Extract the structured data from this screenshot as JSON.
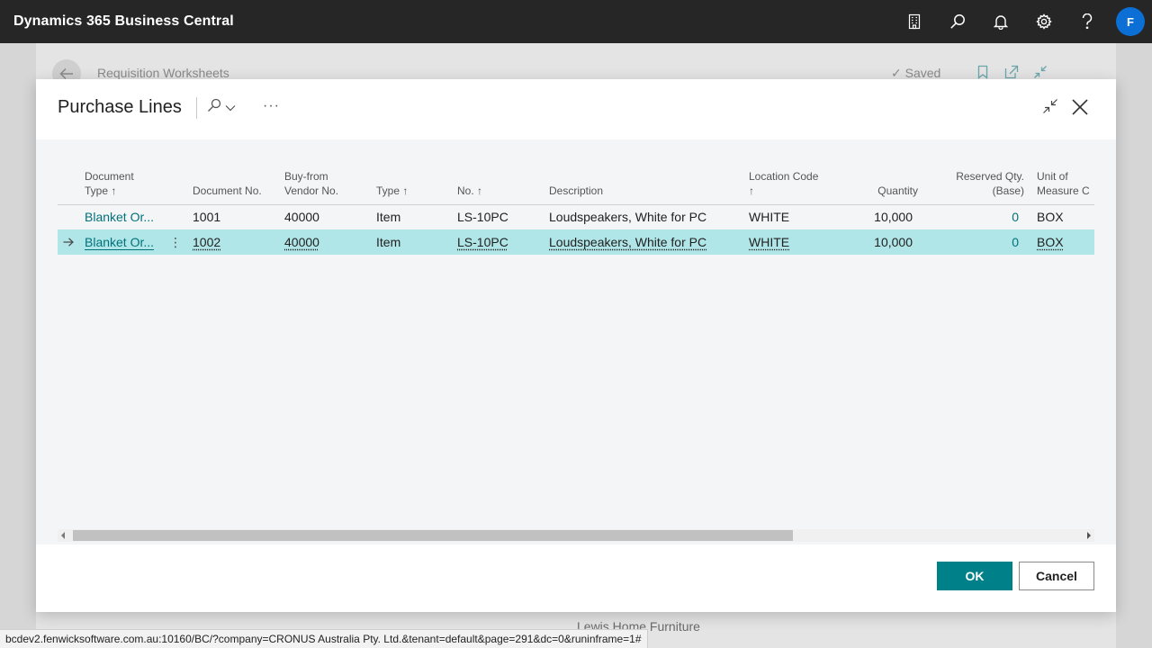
{
  "app": {
    "title": "Dynamics 365 Business Central",
    "avatar_initial": "F"
  },
  "background_page": {
    "breadcrumb": "Requisition Worksheets",
    "saved_label": "Saved",
    "company_name": "Lewis Home Furniture"
  },
  "dialog": {
    "title": "Purchase Lines",
    "columns": [
      {
        "line1": "Document",
        "line2": "Type ↑"
      },
      {
        "line1": "",
        "line2": "Document No."
      },
      {
        "line1": "Buy-from",
        "line2": "Vendor No."
      },
      {
        "line1": "",
        "line2": "Type ↑"
      },
      {
        "line1": "",
        "line2": "No. ↑"
      },
      {
        "line1": "",
        "line2": "Description"
      },
      {
        "line1": "Location Code",
        "line2": "↑"
      },
      {
        "line1": "",
        "line2": "Quantity"
      },
      {
        "line1": "Reserved Qty.",
        "line2": "(Base)"
      },
      {
        "line1": "Unit of",
        "line2": "Measure C"
      }
    ],
    "rows": [
      {
        "document_type": "Blanket Or...",
        "document_no": "1001",
        "vendor_no": "40000",
        "type": "Item",
        "no": "LS-10PC",
        "description": "Loudspeakers, White for PC",
        "location_code": "WHITE",
        "quantity": "10,000",
        "reserved_qty": "0",
        "uom": "BOX",
        "selected": false
      },
      {
        "document_type": "Blanket Or...",
        "document_no": "1002",
        "vendor_no": "40000",
        "type": "Item",
        "no": "LS-10PC",
        "description": "Loudspeakers, White for PC",
        "location_code": "WHITE",
        "quantity": "10,000",
        "reserved_qty": "0",
        "uom": "BOX",
        "selected": true
      }
    ],
    "ok_label": "OK",
    "cancel_label": "Cancel"
  },
  "status_bar": {
    "url": "bcdev2.fenwicksoftware.com.au:10160/BC/?company=CRONUS Australia Pty. Ltd.&tenant=default&page=291&dc=0&runinframe=1#"
  },
  "colors": {
    "appbar": "#262626",
    "accent": "#00818a",
    "link": "#00727a",
    "selected_row": "#b1e6e8",
    "avatar": "#0b6fd6"
  }
}
